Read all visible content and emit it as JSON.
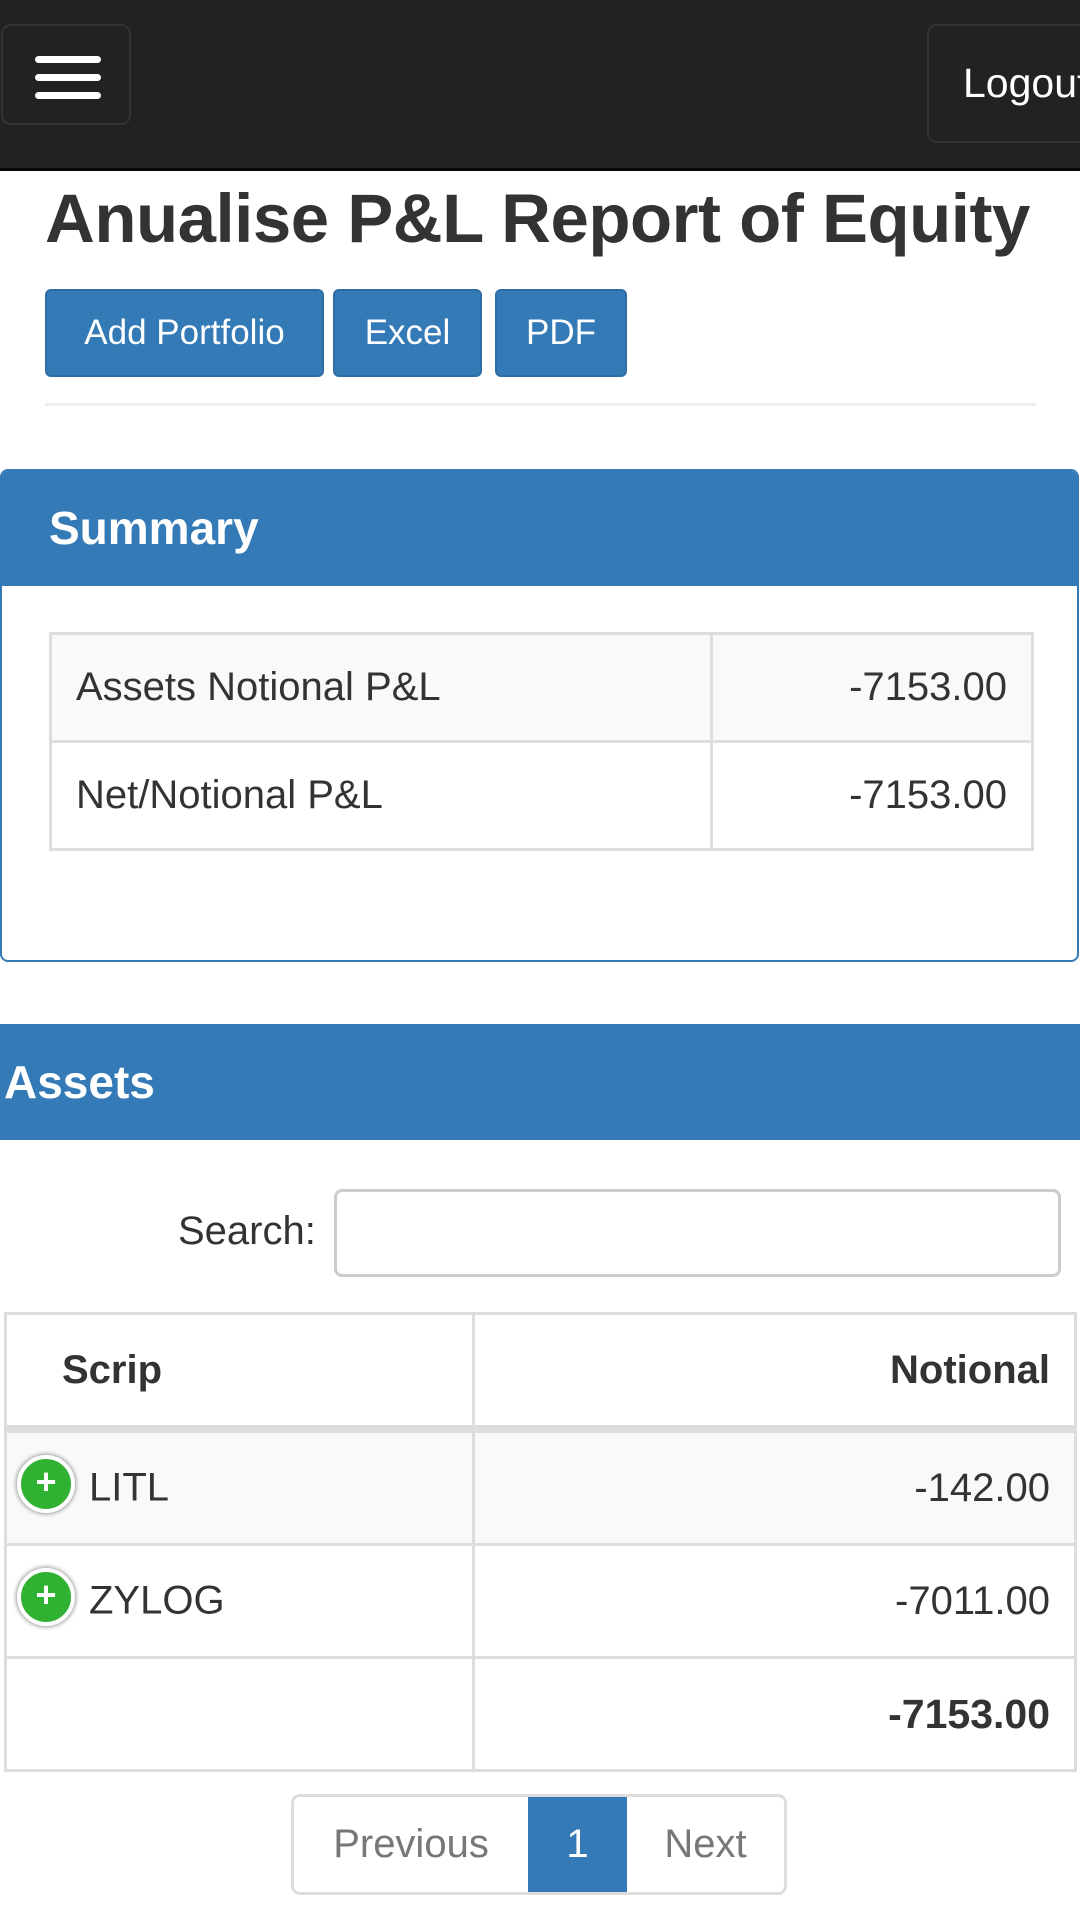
{
  "navbar": {
    "menu_icon": "hamburger-menu-icon",
    "logout_label": "Logout"
  },
  "page": {
    "title": "Anualise P&L Report of Equity",
    "buttons": {
      "add_portfolio": "Add Portfolio",
      "excel": "Excel",
      "pdf": "PDF"
    }
  },
  "summary": {
    "heading": "Summary",
    "rows": [
      {
        "label": "Assets Notional P&L",
        "value": "-7153.00"
      },
      {
        "label": "Net/Notional P&L",
        "value": "-7153.00"
      }
    ]
  },
  "assets": {
    "heading": "Assets",
    "search": {
      "label": "Search:",
      "value": "",
      "placeholder": ""
    },
    "columns": [
      "Scrip",
      "Notional"
    ],
    "rows": [
      {
        "scrip": "LITL",
        "notional": "-142.00",
        "icon": "expand-plus-icon"
      },
      {
        "scrip": "ZYLOG",
        "notional": "-7011.00",
        "icon": "expand-plus-icon"
      }
    ],
    "footer": {
      "scrip": "",
      "notional": "-7153.00"
    },
    "expand_symbol": "+",
    "pagination": {
      "previous": "Previous",
      "current": "1",
      "next": "Next"
    }
  },
  "colors": {
    "primary": "#337ab7",
    "navbar": "#222222",
    "expand_icon": "#31b131"
  }
}
